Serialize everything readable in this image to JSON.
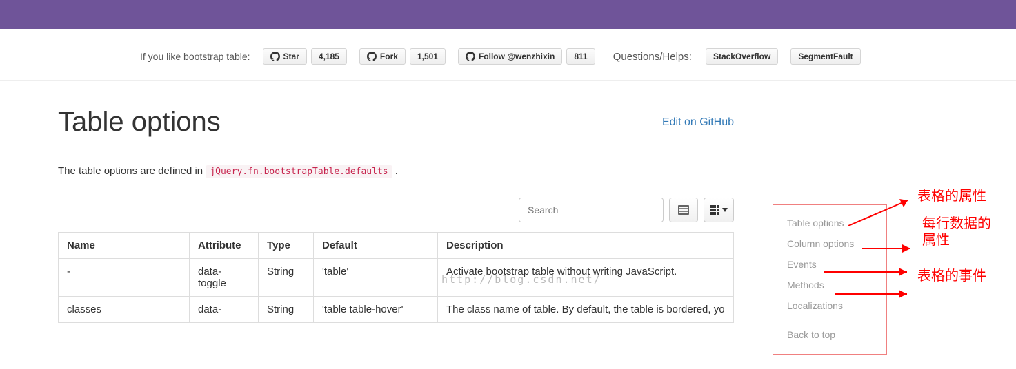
{
  "like_bar": {
    "prefix": "If you like bootstrap table:",
    "star_label": "Star",
    "star_count": "4,185",
    "fork_label": "Fork",
    "fork_count": "1,501",
    "follow_label": "Follow @wenzhixin",
    "follow_count": "811",
    "questions_label": "Questions/Helps:",
    "stackoverflow": "StackOverflow",
    "segmentfault": "SegmentFault"
  },
  "page": {
    "title": "Table options",
    "edit_link": "Edit on GitHub",
    "intro_prefix": "The table options are defined in ",
    "intro_code": "jQuery.fn.bootstrapTable.defaults",
    "intro_suffix": ".",
    "watermark": "http://blog.csdn.net/"
  },
  "toolbar": {
    "search_placeholder": "Search"
  },
  "table": {
    "columns": [
      "Name",
      "Attribute",
      "Type",
      "Default",
      "Description"
    ],
    "rows": [
      {
        "name": "-",
        "attribute": "data-toggle",
        "type": "String",
        "default": "'table'",
        "description": "Activate bootstrap table without writing JavaScript."
      },
      {
        "name": "classes",
        "attribute": "data-",
        "type": "String",
        "default": "'table table-hover'",
        "description": "The class name of table. By default, the table is bordered, yo"
      }
    ]
  },
  "sidenav": {
    "items": [
      "Table options",
      "Column options",
      "Events",
      "Methods",
      "Localizations"
    ],
    "back": "Back to top"
  },
  "annotations": {
    "a1": "表格的属性",
    "a2a": "每行数据的",
    "a2b": "属性",
    "a3": "表格的事件"
  }
}
